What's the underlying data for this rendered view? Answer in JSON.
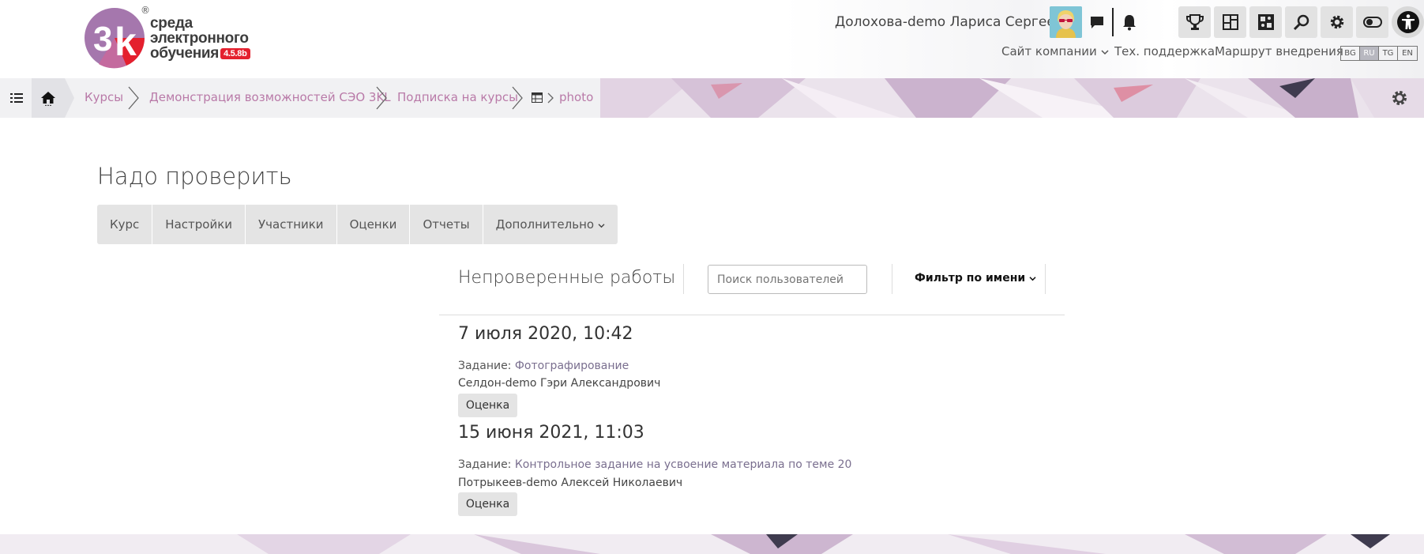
{
  "brand": {
    "name_line1": "среда",
    "name_line2": "электронного",
    "name_line3": "обучения",
    "version": "4.5.8b",
    "reg_mark": "®",
    "accent": "#e4202e"
  },
  "header": {
    "user_name": "Долохова-demo Лариса Сергеевна",
    "icons": [
      "chat-icon",
      "bell-icon"
    ],
    "tools": [
      "trophy-icon",
      "dashboard-icon",
      "puzzle-icon",
      "search-icon",
      "gear-icon",
      "toggle-icon",
      "accessibility-icon"
    ],
    "nav": {
      "company_site": "Сайт компании",
      "support": "Тех. поддержка",
      "route": "Маршрут внедрения"
    },
    "languages": [
      "BG",
      "RU",
      "TG",
      "EN"
    ],
    "active_language": "RU"
  },
  "breadcrumb": {
    "items": [
      "Курсы",
      "Демонстрация возможностей СЭО 3KL",
      "Подписка на курсы",
      "photo"
    ],
    "link_color": "#b97aa8"
  },
  "page": {
    "title": "Надо проверить",
    "tabs": [
      "Курс",
      "Настройки",
      "Участники",
      "Оценки",
      "Отчеты",
      "Дополнительно"
    ]
  },
  "section": {
    "title": "Непроверенные работы",
    "search_placeholder": "Поиск пользователей",
    "filter_label": "Фильтр по имени"
  },
  "submissions": [
    {
      "date": "7 июля 2020, 10:42",
      "task_prefix": "Задание:",
      "task_name": "Фотографирование",
      "student": "Селдон-demo Гэри Александрович",
      "button": "Оценка"
    },
    {
      "date": "15 июня 2021, 11:03",
      "task_prefix": "Задание:",
      "task_name": "Контрольное задание на усвоение материала по теме 20",
      "student": "Потрыкеев-demo Алексей Николаевич",
      "button": "Оценка"
    }
  ]
}
